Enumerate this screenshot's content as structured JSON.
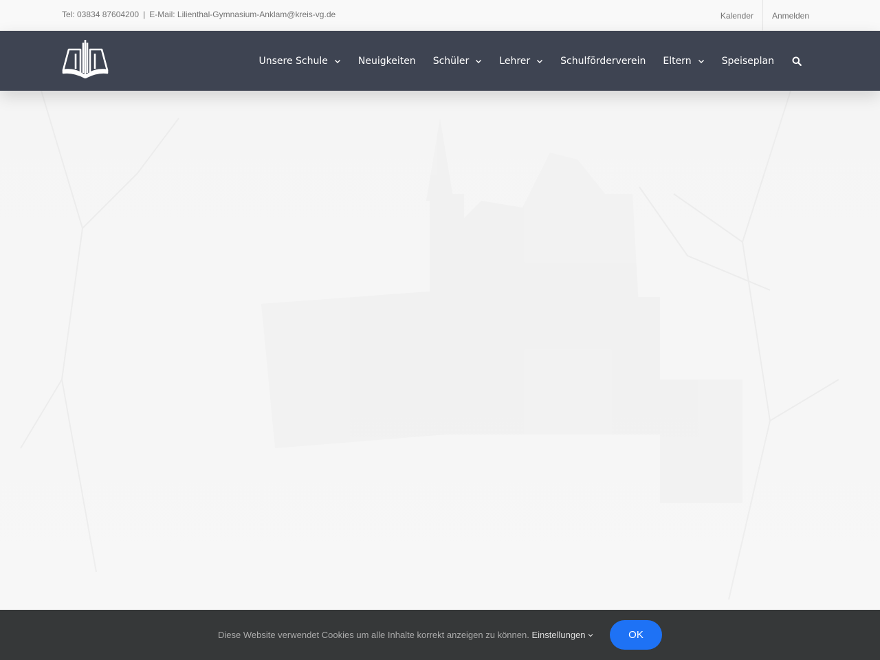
{
  "topbar": {
    "phone": "Tel: 03834 87604200",
    "separator": "|",
    "email": "E-Mail: Lilienthal-Gymnasium-Anklam@kreis-vg.de",
    "links": [
      "Kalender",
      "Anmelden"
    ]
  },
  "header": {
    "logo_icon": "book-pillars-logo",
    "nav": [
      {
        "label": "Unsere Schule",
        "dropdown": true
      },
      {
        "label": "Neuigkeiten",
        "dropdown": false
      },
      {
        "label": "Schüler",
        "dropdown": true
      },
      {
        "label": "Lehrer",
        "dropdown": true
      },
      {
        "label": "Schulförderverein",
        "dropdown": false
      },
      {
        "label": "Eltern",
        "dropdown": true
      },
      {
        "label": "Speiseplan",
        "dropdown": false
      }
    ],
    "search_icon": "search-icon"
  },
  "cookie": {
    "message": "Diese Website verwendet Cookies um alle Inhalte korrekt anzeigen zu können.",
    "settings_label": "Einstellungen",
    "ok_label": "OK"
  },
  "colors": {
    "header_bg": "#3e4452",
    "topbar_bg": "#f9f9f9",
    "cookie_bg": "#363839",
    "button_accent": "#1e72f5"
  }
}
